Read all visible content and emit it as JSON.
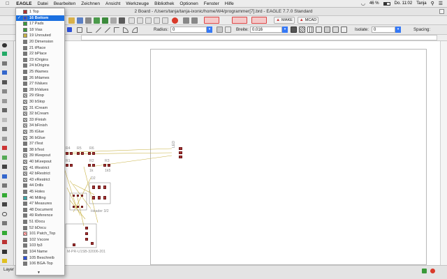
{
  "menubar": {
    "items": [
      "EAGLE",
      "Datei",
      "Bearbeiten",
      "Zeichnen",
      "Ansicht",
      "Werkzeuge",
      "Bibliothek",
      "Optionen",
      "Fenster",
      "Hilfe"
    ],
    "battery": "46 %",
    "clock": "Do. 11:02",
    "user": "Tanja"
  },
  "window": {
    "title": "2 Board - /Users/tanja/tanja-ixonic/home/W4/programmer[7].brd - EAGLE 7.7.0 Standard"
  },
  "toolbar": {
    "make_label": "MAKE",
    "mcad_label": "MCAD",
    "radius_label": "Radius:",
    "radius_value": "0",
    "breite_label": "Breite:",
    "breite_value": "0.016",
    "isolate_label": "Isolate:",
    "isolate_value": "0",
    "spacing_label": "Spacing:"
  },
  "statusbar": {
    "layer_label": "Layer"
  },
  "layers": {
    "selected_index": 1,
    "items": [
      {
        "name": "1 Top",
        "color": "#b03030",
        "style": "solid"
      },
      {
        "name": "16 Bottom",
        "color": "#2b4fd8",
        "style": "solid"
      },
      {
        "name": "17 Pads",
        "color": "#3a9a3a",
        "style": "solid"
      },
      {
        "name": "18 Vias",
        "color": "#3a9a3a",
        "style": "solid"
      },
      {
        "name": "19 Unrouted",
        "color": "#c9b347",
        "style": "solid"
      },
      {
        "name": "20 Dimension",
        "color": "#777777",
        "style": "solid"
      },
      {
        "name": "21 tPlace",
        "color": "#777777",
        "style": "solid"
      },
      {
        "name": "22 bPlace",
        "color": "#777777",
        "style": "solid"
      },
      {
        "name": "23 tOrigins",
        "color": "#777777",
        "style": "solid"
      },
      {
        "name": "24 bOrigins",
        "color": "#777777",
        "style": "solid"
      },
      {
        "name": "25 tNames",
        "color": "#777777",
        "style": "solid"
      },
      {
        "name": "26 bNames",
        "color": "#777777",
        "style": "solid"
      },
      {
        "name": "27 tValues",
        "color": "#777777",
        "style": "solid"
      },
      {
        "name": "28 bValues",
        "color": "#777777",
        "style": "solid"
      },
      {
        "name": "29 tStop",
        "color": "#777777",
        "style": "hatch"
      },
      {
        "name": "30 bStop",
        "color": "#777777",
        "style": "hatch"
      },
      {
        "name": "31 tCream",
        "color": "#777777",
        "style": "hatch"
      },
      {
        "name": "32 bCream",
        "color": "#777777",
        "style": "hatch"
      },
      {
        "name": "33 tFinish",
        "color": "#777777",
        "style": "hatch"
      },
      {
        "name": "34 bFinish",
        "color": "#c9b347",
        "style": "hatch"
      },
      {
        "name": "35 tGlue",
        "color": "#777777",
        "style": "hatch"
      },
      {
        "name": "36 bGlue",
        "color": "#777777",
        "style": "hatch"
      },
      {
        "name": "37 tTest",
        "color": "#777777",
        "style": "solid"
      },
      {
        "name": "38 bTest",
        "color": "#777777",
        "style": "solid"
      },
      {
        "name": "39 tKeepout",
        "color": "#777777",
        "style": "hatch"
      },
      {
        "name": "40 bKeepout",
        "color": "#777777",
        "style": "hatch"
      },
      {
        "name": "41 tRestrict",
        "color": "#777777",
        "style": "hatch"
      },
      {
        "name": "42 bRestrict",
        "color": "#777777",
        "style": "hatch"
      },
      {
        "name": "43 vRestrict",
        "color": "#777777",
        "style": "hatch"
      },
      {
        "name": "44 Drills",
        "color": "#777777",
        "style": "solid"
      },
      {
        "name": "45 Holes",
        "color": "#777777",
        "style": "solid"
      },
      {
        "name": "46 Milling",
        "color": "#3aa6a6",
        "style": "solid"
      },
      {
        "name": "47 Measures",
        "color": "#777777",
        "style": "solid"
      },
      {
        "name": "48 Document",
        "color": "#777777",
        "style": "solid"
      },
      {
        "name": "49 Reference",
        "color": "#777777",
        "style": "solid"
      },
      {
        "name": "51 tDocu",
        "color": "#777777",
        "style": "solid"
      },
      {
        "name": "52 bDocu",
        "color": "#777777",
        "style": "solid"
      },
      {
        "name": "101 Patch_Top",
        "color": "#d33333",
        "style": "hatchr"
      },
      {
        "name": "102 Vscore",
        "color": "#777777",
        "style": "solid"
      },
      {
        "name": "103 fp3",
        "color": "#777777",
        "style": "solid"
      },
      {
        "name": "104 Name",
        "color": "#777777",
        "style": "solid"
      },
      {
        "name": "105 Beschreib",
        "color": "#2b4fd8",
        "style": "solid"
      },
      {
        "name": "106 BGA-Top",
        "color": "#777777",
        "style": "solid"
      }
    ]
  },
  "board": {
    "labels": {
      "r4": "R4",
      "r5": "R5",
      "r6": "R6",
      "r1": "R1",
      "r2": "R2",
      "r3": "R3",
      "d2": "D2",
      "r2v": "1k",
      "r3v": "1k5",
      "header": "Header 3/2",
      "u1": "M-PR-U1SB-32006-201",
      "led": "LED"
    }
  }
}
